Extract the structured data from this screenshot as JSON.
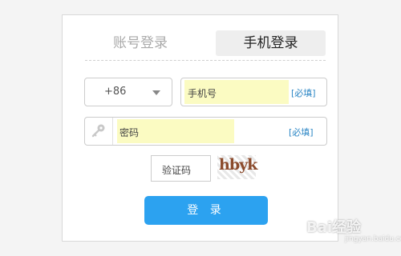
{
  "tabs": {
    "account_login": "账号登录",
    "mobile_login": "手机登录"
  },
  "phone_row": {
    "country_code": "+86",
    "phone_placeholder": "手机号",
    "required_label": "[必填]"
  },
  "password_row": {
    "placeholder": "密码",
    "required_label": "[必填]"
  },
  "captcha": {
    "input_placeholder": "验证码",
    "image_text": "hbyk"
  },
  "login_button": "登 录",
  "watermark": {
    "brand": "Bai经验",
    "url": "jingyan.baidu.com"
  },
  "colors": {
    "accent": "#2ca2f0",
    "autofill": "#fbfbc2",
    "required": "#2b86c5"
  },
  "icons": {
    "password_field": "key-icon",
    "country_dropdown": "caret-down-icon"
  }
}
